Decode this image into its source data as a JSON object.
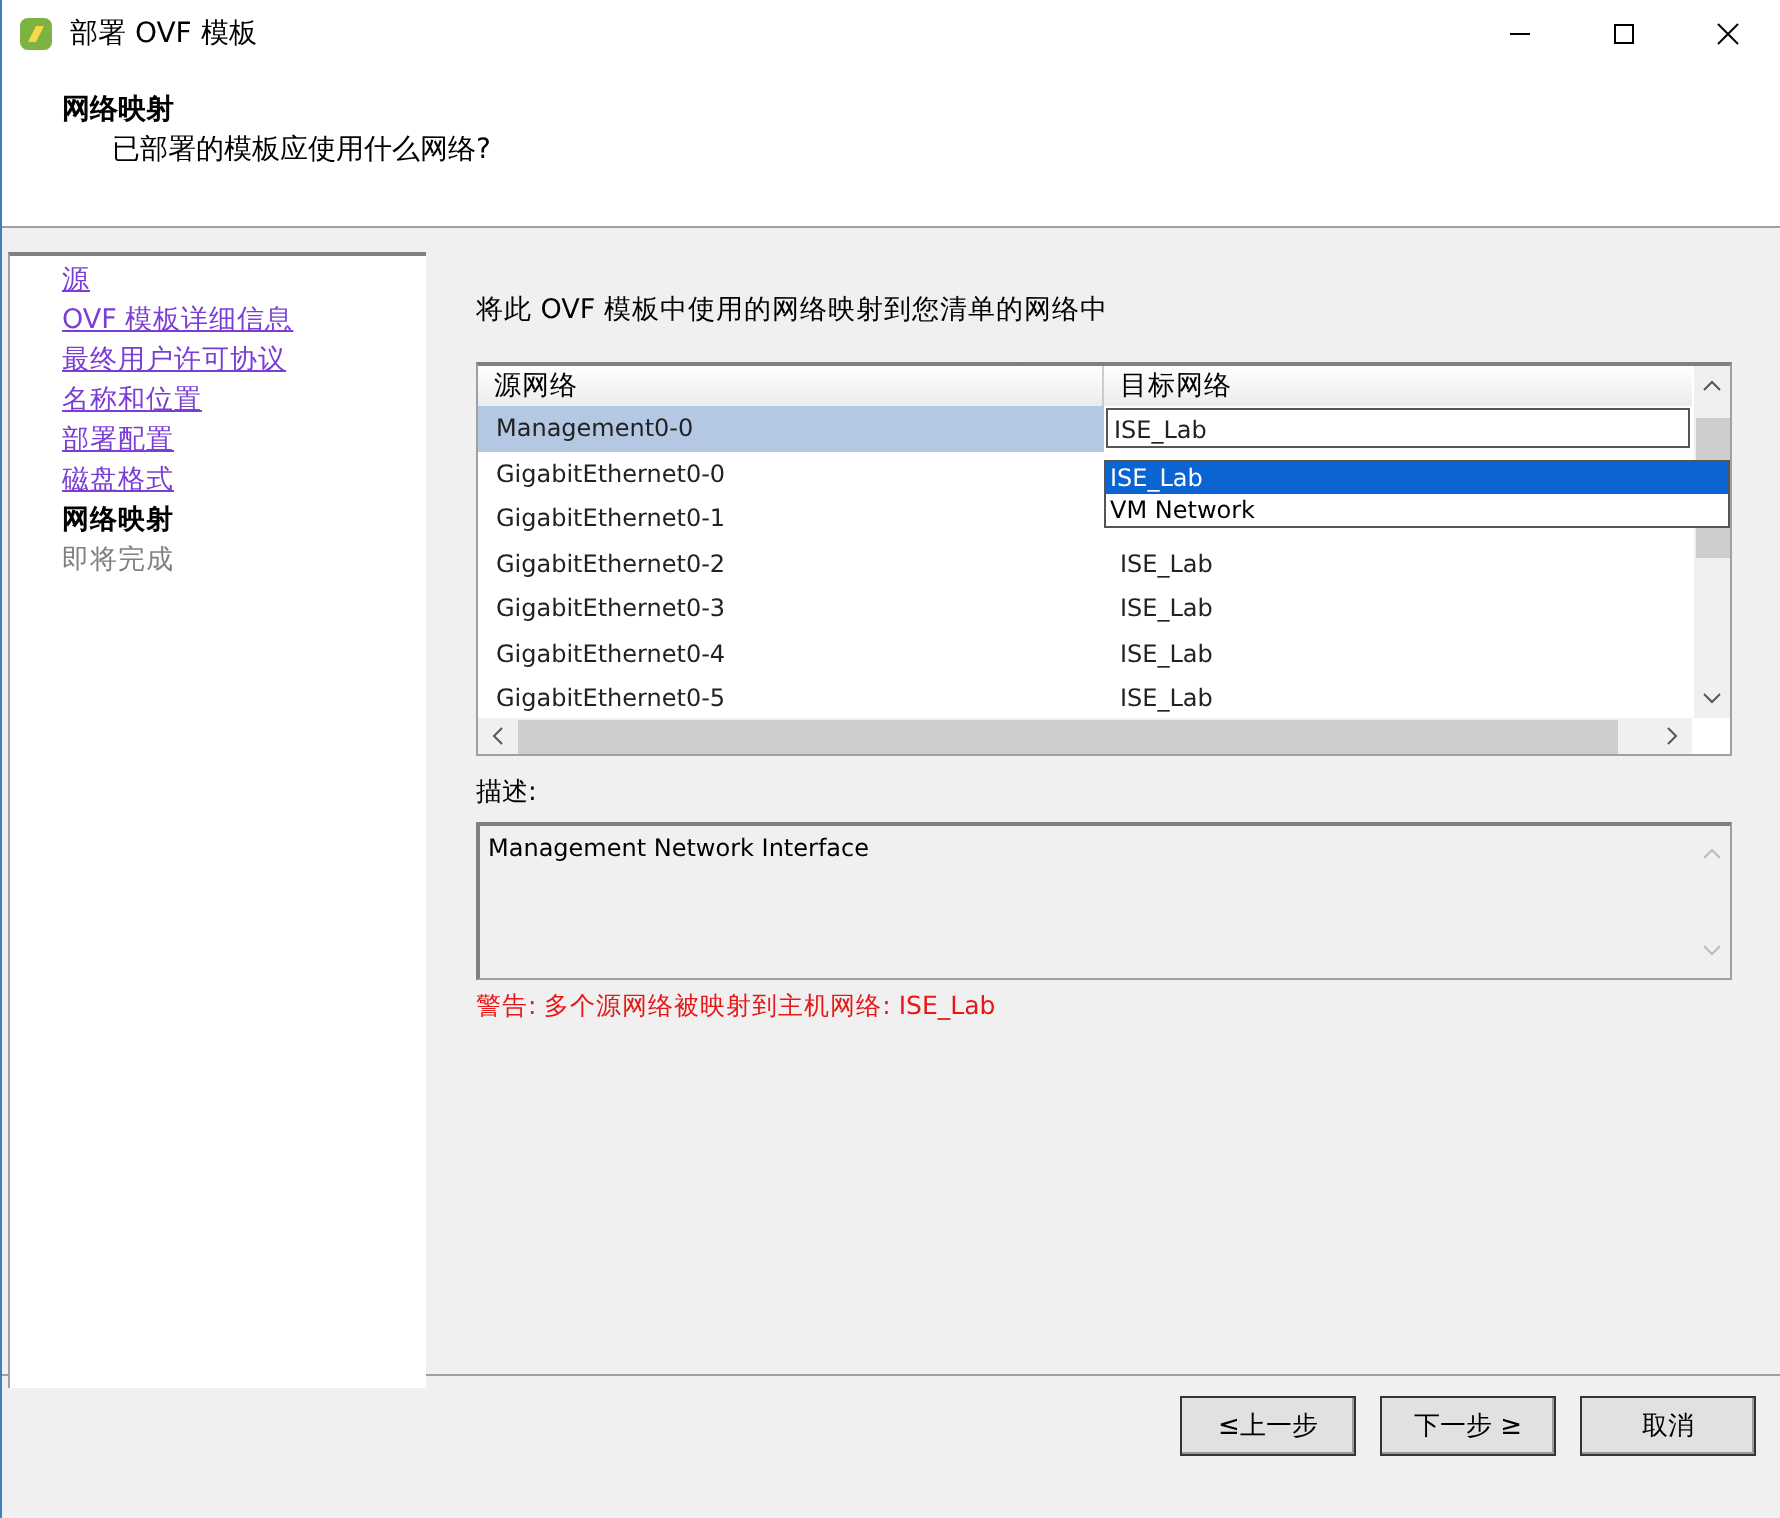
{
  "window": {
    "title": "部署 OVF 模板"
  },
  "header": {
    "title": "网络映射",
    "subtitle": "已部署的模板应使用什么网络?"
  },
  "steps": [
    {
      "label": "源",
      "kind": "link"
    },
    {
      "label": "OVF 模板详细信息",
      "kind": "link"
    },
    {
      "label": "最终用户许可协议",
      "kind": "link"
    },
    {
      "label": "名称和位置",
      "kind": "link"
    },
    {
      "label": "部署配置",
      "kind": "link"
    },
    {
      "label": "磁盘格式",
      "kind": "link"
    },
    {
      "label": "网络映射",
      "kind": "current"
    },
    {
      "label": "即将完成",
      "kind": "pending"
    }
  ],
  "instruction": "将此 OVF 模板中使用的网络映射到您清单的网络中",
  "table": {
    "columns": [
      "源网络",
      "目标网络"
    ],
    "rows": [
      {
        "source": "Management0-0",
        "target": "ISE_Lab",
        "selected": true
      },
      {
        "source": "GigabitEthernet0-0",
        "selected": false
      },
      {
        "source": "GigabitEthernet0-1",
        "selected": false
      },
      {
        "source": "GigabitEthernet0-2",
        "target": "ISE_Lab",
        "selected": false
      },
      {
        "source": "GigabitEthernet0-3",
        "target": "ISE_Lab",
        "selected": false
      },
      {
        "source": "GigabitEthernet0-4",
        "target": "ISE_Lab",
        "selected": false
      },
      {
        "source": "GigabitEthernet0-5",
        "target": "ISE_Lab",
        "selected": false
      }
    ]
  },
  "dropdown": {
    "options": [
      {
        "label": "ISE_Lab",
        "selected": true
      },
      {
        "label": "VM Network",
        "selected": false
      }
    ]
  },
  "description": {
    "label": "描述:",
    "text": "Management Network Interface"
  },
  "warning": "警告: 多个源网络被映射到主机网络: ISE_Lab",
  "buttons": [
    {
      "label": "≤上一步",
      "disabled": false
    },
    {
      "label": "下一步 ≥",
      "disabled": false
    },
    {
      "label": "取消",
      "disabled": false
    }
  ]
}
